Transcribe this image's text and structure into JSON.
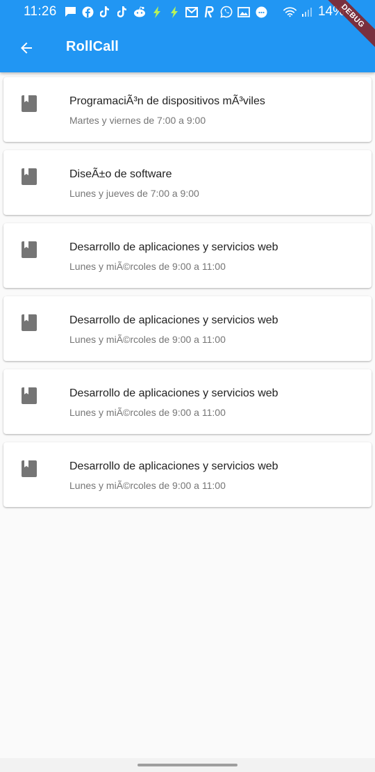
{
  "status_bar": {
    "time": "11:26",
    "battery": "14%",
    "notification_icons": [
      "chat-icon",
      "facebook-icon",
      "tiktok-icon",
      "tiktok-icon",
      "reddit-icon",
      "bolt-icon",
      "bolt-icon",
      "mail-icon",
      "r-app-icon",
      "whatsapp-icon",
      "gallery-icon",
      "app-icon"
    ],
    "debug_label": "DEBUG"
  },
  "app_bar": {
    "title": "RollCall",
    "background": "#2196f3"
  },
  "courses": [
    {
      "title": "ProgramaciÃ³n de dispositivos mÃ³viles",
      "schedule": "Martes y viernes de 7:00 a 9:00"
    },
    {
      "title": "DiseÃ±o de software",
      "schedule": "Lunes y jueves de 7:00 a 9:00"
    },
    {
      "title": "Desarrollo de aplicaciones y servicios web",
      "schedule": "Lunes y miÃ©rcoles de 9:00 a 11:00"
    },
    {
      "title": "Desarrollo de aplicaciones y servicios web",
      "schedule": "Lunes y miÃ©rcoles de 9:00 a 11:00"
    },
    {
      "title": "Desarrollo de aplicaciones y servicios web",
      "schedule": "Lunes y miÃ©rcoles de 9:00 a 11:00"
    },
    {
      "title": "Desarrollo de aplicaciones y servicios web",
      "schedule": "Lunes y miÃ©rcoles de 9:00 a 11:00"
    }
  ]
}
